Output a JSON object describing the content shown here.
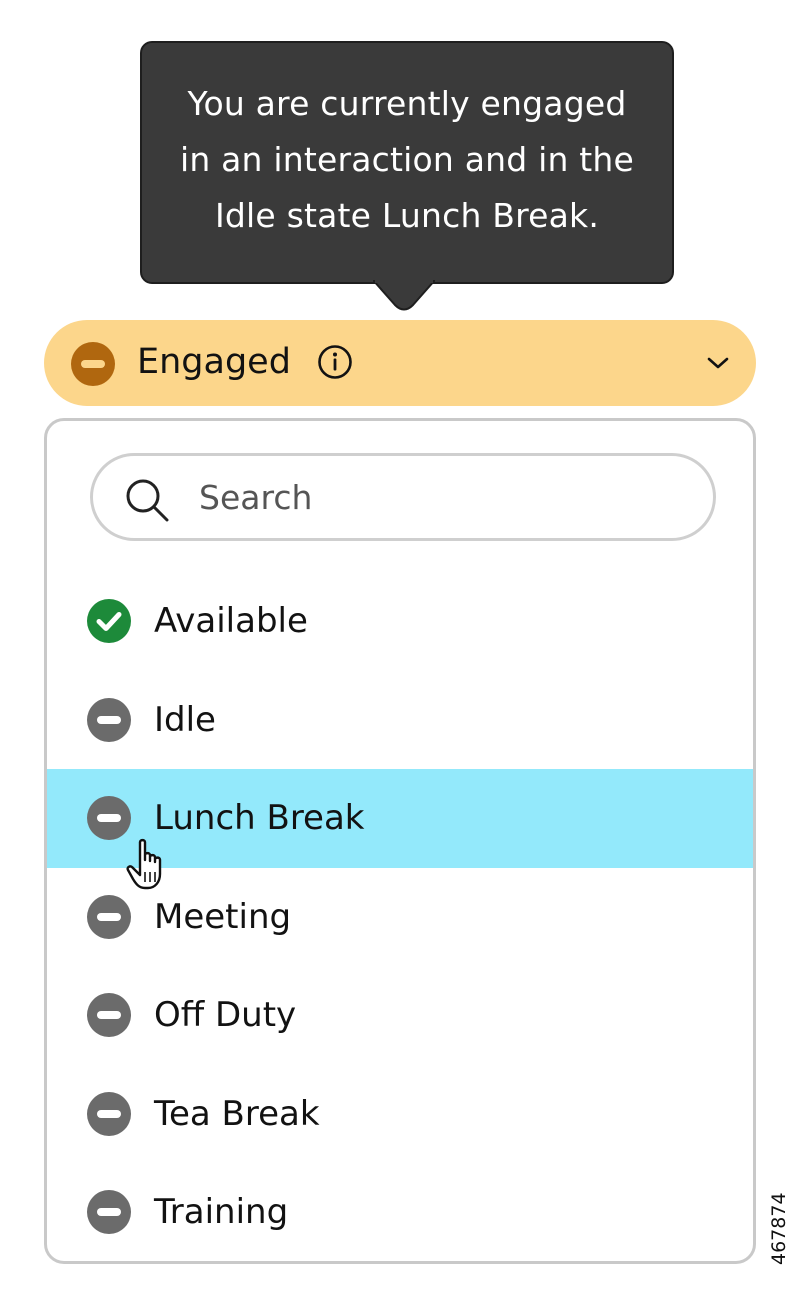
{
  "tooltip": {
    "text": "You are currently engaged in an interaction and in the Idle state Lunch Break."
  },
  "status": {
    "label": "Engaged",
    "icon": "minus-circle-icon",
    "color": "#fcd68b",
    "icon_color": "#b0670f"
  },
  "search": {
    "placeholder": "Search",
    "value": ""
  },
  "options": [
    {
      "label": "Available",
      "icon": "check-circle-icon",
      "color": "#1d8a3a"
    },
    {
      "label": "Idle",
      "icon": "minus-circle-icon",
      "color": "#6b6b6b"
    },
    {
      "label": "Lunch Break",
      "icon": "minus-circle-icon",
      "color": "#6b6b6b",
      "highlighted": true
    },
    {
      "label": "Meeting",
      "icon": "minus-circle-icon",
      "color": "#6b6b6b"
    },
    {
      "label": "Off Duty",
      "icon": "minus-circle-icon",
      "color": "#6b6b6b"
    },
    {
      "label": "Tea Break",
      "icon": "minus-circle-icon",
      "color": "#6b6b6b"
    },
    {
      "label": "Training",
      "icon": "minus-circle-icon",
      "color": "#6b6b6b"
    }
  ],
  "highlight_color": "#93e9fb",
  "figure_id": "467874"
}
